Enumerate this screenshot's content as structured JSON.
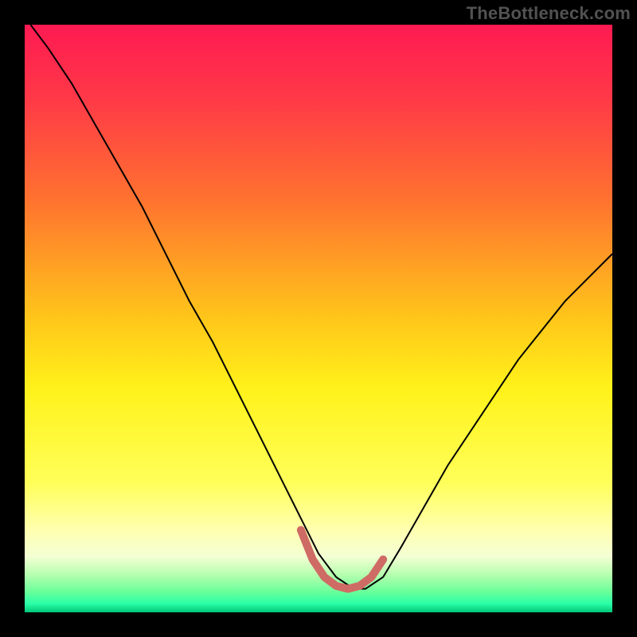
{
  "watermark": "TheBottleneck.com",
  "chart_data": {
    "type": "line",
    "title": "",
    "xlabel": "",
    "ylabel": "",
    "xlim": [
      0,
      100
    ],
    "ylim": [
      0,
      100
    ],
    "gradient_stops": [
      {
        "offset": 0.0,
        "color": "#ff1a52"
      },
      {
        "offset": 0.12,
        "color": "#ff3748"
      },
      {
        "offset": 0.3,
        "color": "#ff732f"
      },
      {
        "offset": 0.5,
        "color": "#ffc61a"
      },
      {
        "offset": 0.62,
        "color": "#fff21a"
      },
      {
        "offset": 0.78,
        "color": "#ffff5a"
      },
      {
        "offset": 0.86,
        "color": "#ffffb0"
      },
      {
        "offset": 0.905,
        "color": "#f4ffd4"
      },
      {
        "offset": 0.935,
        "color": "#b8ffb0"
      },
      {
        "offset": 0.965,
        "color": "#6aff9a"
      },
      {
        "offset": 0.985,
        "color": "#2cffa8"
      },
      {
        "offset": 1.0,
        "color": "#00c878"
      }
    ],
    "series": [
      {
        "name": "curve",
        "stroke": "#000000",
        "stroke_width": 2,
        "x": [
          1,
          4,
          8,
          12,
          16,
          20,
          24,
          28,
          32,
          36,
          40,
          44,
          47,
          50,
          53,
          56,
          58,
          61,
          64,
          68,
          72,
          76,
          80,
          84,
          88,
          92,
          96,
          100
        ],
        "y": [
          100,
          96,
          90,
          83,
          76,
          69,
          61,
          53,
          46,
          38,
          30,
          22,
          16,
          10,
          6,
          4,
          4,
          6,
          11,
          18,
          25,
          31,
          37,
          43,
          48,
          53,
          57,
          61
        ]
      },
      {
        "name": "highlight-band",
        "stroke": "#cf6b65",
        "stroke_width": 10,
        "linecap": "round",
        "x": [
          47,
          49,
          51,
          53,
          55,
          57,
          59,
          61
        ],
        "y": [
          14,
          9,
          6,
          4.5,
          4,
          4.5,
          6,
          9
        ]
      }
    ]
  }
}
